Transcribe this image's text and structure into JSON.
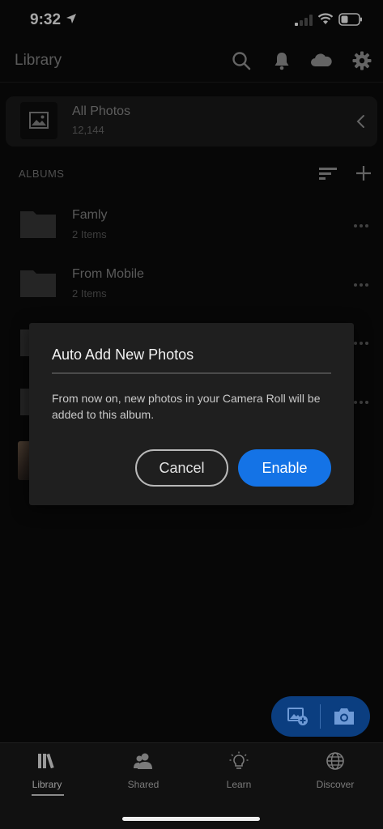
{
  "status_bar": {
    "time": "9:32"
  },
  "header": {
    "title": "Library",
    "icons": [
      "search-icon",
      "bell-icon",
      "cloud-icon",
      "gear-icon"
    ]
  },
  "all_photos": {
    "title": "All Photos",
    "count": "12,144"
  },
  "albums": {
    "section_title": "ALBUMS",
    "items": [
      {
        "name": "Famly",
        "count": "2 Items"
      },
      {
        "name": "From Mobile",
        "count": "2 Items"
      }
    ]
  },
  "dialog": {
    "title": "Auto Add New Photos",
    "body": "From now on, new photos in your Camera Roll will be added to this album.",
    "cancel_label": "Cancel",
    "enable_label": "Enable"
  },
  "tabs": [
    {
      "label": "Library",
      "active": true
    },
    {
      "label": "Shared",
      "active": false
    },
    {
      "label": "Learn",
      "active": false
    },
    {
      "label": "Discover",
      "active": false
    }
  ],
  "colors": {
    "accent": "#1473e6",
    "fab": "#0b3e80",
    "background": "#0b0b0b"
  }
}
